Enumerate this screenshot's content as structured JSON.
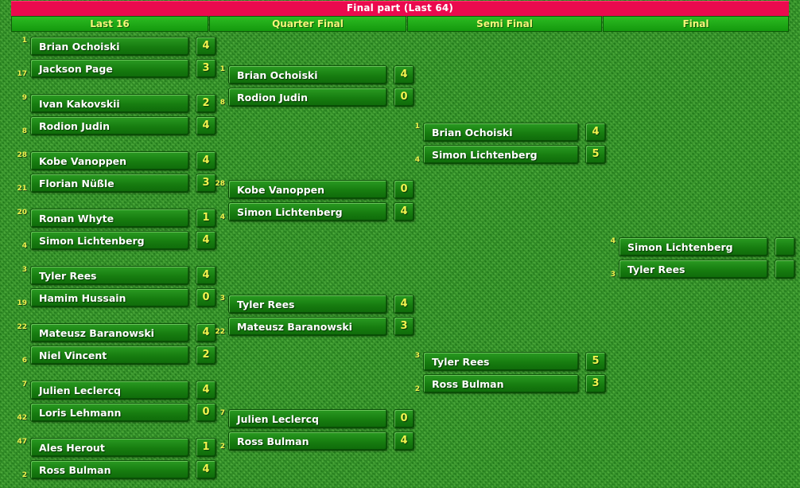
{
  "title": "Final part (Last 64)",
  "rounds": [
    {
      "label": "Last 16"
    },
    {
      "label": "Quarter Final"
    },
    {
      "label": "Semi Final"
    },
    {
      "label": "Final"
    }
  ],
  "last16": [
    {
      "top": {
        "seed": "1",
        "name": "Brian Ochoiski",
        "score": "4"
      },
      "bottom": {
        "seed": "17",
        "name": "Jackson Page",
        "score": "3"
      }
    },
    {
      "top": {
        "seed": "9",
        "name": "Ivan Kakovskii",
        "score": "2"
      },
      "bottom": {
        "seed": "8",
        "name": "Rodion Judin",
        "score": "4"
      }
    },
    {
      "top": {
        "seed": "28",
        "name": "Kobe Vanoppen",
        "score": "4"
      },
      "bottom": {
        "seed": "21",
        "name": "Florian Nüßle",
        "score": "3"
      }
    },
    {
      "top": {
        "seed": "20",
        "name": "Ronan Whyte",
        "score": "1"
      },
      "bottom": {
        "seed": "4",
        "name": "Simon Lichtenberg",
        "score": "4"
      }
    },
    {
      "top": {
        "seed": "3",
        "name": "Tyler Rees",
        "score": "4"
      },
      "bottom": {
        "seed": "19",
        "name": "Hamim Hussain",
        "score": "0"
      }
    },
    {
      "top": {
        "seed": "22",
        "name": "Mateusz Baranowski",
        "score": "4"
      },
      "bottom": {
        "seed": "6",
        "name": "Niel Vincent",
        "score": "2"
      }
    },
    {
      "top": {
        "seed": "7",
        "name": "Julien Leclercq",
        "score": "4"
      },
      "bottom": {
        "seed": "42",
        "name": "Loris Lehmann",
        "score": "0"
      }
    },
    {
      "top": {
        "seed": "47",
        "name": "Ales Herout",
        "score": "1"
      },
      "bottom": {
        "seed": "2",
        "name": "Ross Bulman",
        "score": "4"
      }
    }
  ],
  "quarter": [
    {
      "top": {
        "seed": "1",
        "name": "Brian Ochoiski",
        "score": "4"
      },
      "bottom": {
        "seed": "8",
        "name": "Rodion Judin",
        "score": "0"
      }
    },
    {
      "top": {
        "seed": "28",
        "name": "Kobe Vanoppen",
        "score": "0"
      },
      "bottom": {
        "seed": "4",
        "name": "Simon Lichtenberg",
        "score": "4"
      }
    },
    {
      "top": {
        "seed": "3",
        "name": "Tyler Rees",
        "score": "4"
      },
      "bottom": {
        "seed": "22",
        "name": "Mateusz Baranowski",
        "score": "3"
      }
    },
    {
      "top": {
        "seed": "7",
        "name": "Julien Leclercq",
        "score": "0"
      },
      "bottom": {
        "seed": "2",
        "name": "Ross Bulman",
        "score": "4"
      }
    }
  ],
  "semi": [
    {
      "top": {
        "seed": "1",
        "name": "Brian Ochoiski",
        "score": "4"
      },
      "bottom": {
        "seed": "4",
        "name": "Simon Lichtenberg",
        "score": "5"
      }
    },
    {
      "top": {
        "seed": "3",
        "name": "Tyler Rees",
        "score": "5"
      },
      "bottom": {
        "seed": "2",
        "name": "Ross Bulman",
        "score": "3"
      }
    }
  ],
  "final": [
    {
      "top": {
        "seed": "4",
        "name": "Simon Lichtenberg",
        "score": ""
      },
      "bottom": {
        "seed": "3",
        "name": "Tyler Rees",
        "score": ""
      }
    }
  ]
}
